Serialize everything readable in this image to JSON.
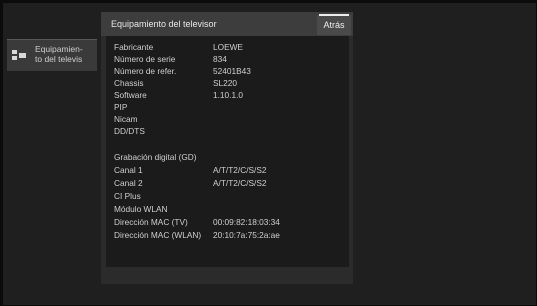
{
  "side_panel": {
    "label": "Equipamien-\nto del televis"
  },
  "dialog": {
    "title": "Equipamiento del televisor",
    "back_label": "Atrás",
    "rows": [
      {
        "label": "Fabricante",
        "value": "LOEWE"
      },
      {
        "label": "Número de serie",
        "value": "834"
      },
      {
        "label": "Número de refer.",
        "value": "52401B43"
      },
      {
        "label": "Chassis",
        "value": "SL220"
      },
      {
        "label": "Software",
        "value": "1.10.1.0"
      },
      {
        "label": "PIP",
        "value": ""
      },
      {
        "label": "Nicam",
        "value": ""
      },
      {
        "label": "DD/DTS",
        "value": ""
      },
      {
        "label": "Grabación digital (GD)",
        "value": ""
      },
      {
        "label": "Canal 1",
        "value": "A/T/T2/C/S/S2"
      },
      {
        "label": "Canal 2",
        "value": "A/T/T2/C/S/S2"
      },
      {
        "label": "CI Plus",
        "value": ""
      },
      {
        "label": "Módulo WLAN",
        "value": ""
      },
      {
        "label": "Dirección MAC (TV)",
        "value": "00:09:82:18:03:34"
      },
      {
        "label": "Dirección MAC (WLAN)",
        "value": "20:10:7a:75:2a:ae"
      }
    ]
  }
}
